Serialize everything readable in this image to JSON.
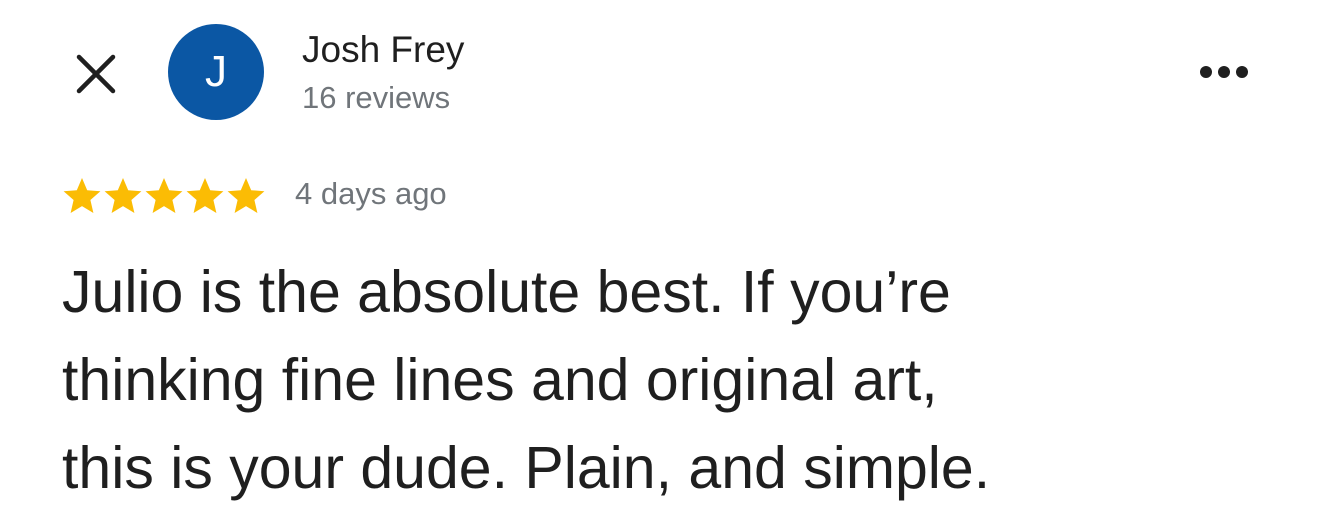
{
  "reviewer": {
    "initial": "J",
    "name": "Josh Frey",
    "review_count": "16 reviews",
    "avatar_color": "#0b57a4"
  },
  "review": {
    "rating": 5,
    "max_rating": 5,
    "star_color": "#fbbc04",
    "time": "4 days ago",
    "text_lines": [
      "Julio is the absolute best. If you’re",
      "thinking fine lines and original art,",
      "this is your dude. Plain, and simple."
    ]
  },
  "icons": {
    "close": "close-icon",
    "more": "more-horiz-icon",
    "star": "star-icon"
  }
}
